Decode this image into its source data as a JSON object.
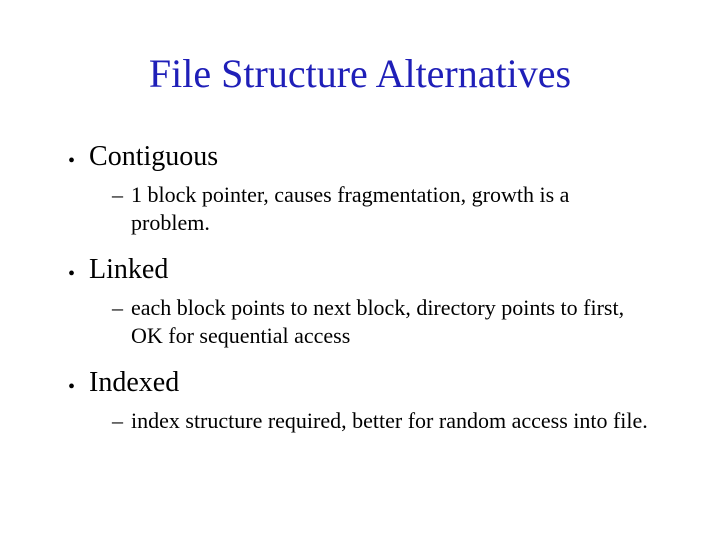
{
  "title": "File Structure Alternatives",
  "items": [
    {
      "label": "Contiguous",
      "sub": "1 block pointer, causes fragmentation, growth is a problem."
    },
    {
      "label": "Linked",
      "sub": "each block points to next block, directory points to first, OK for sequential access"
    },
    {
      "label": "Indexed",
      "sub": "index structure required, better for random access into file."
    }
  ]
}
